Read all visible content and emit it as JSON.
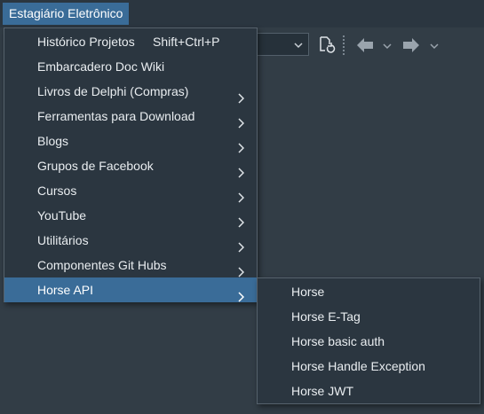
{
  "menubar": {
    "title": "Estagiário Eletrônico"
  },
  "main_menu": {
    "items": [
      {
        "label": "Histórico Projetos",
        "shortcut": "Shift+Ctrl+P",
        "submenu": false,
        "active": false
      },
      {
        "label": "Embarcadero Doc Wiki",
        "shortcut": "",
        "submenu": false,
        "active": false
      },
      {
        "label": "Livros de Delphi (Compras)",
        "shortcut": "",
        "submenu": true,
        "active": false
      },
      {
        "label": "Ferramentas para Download",
        "shortcut": "",
        "submenu": true,
        "active": false
      },
      {
        "label": "Blogs",
        "shortcut": "",
        "submenu": true,
        "active": false
      },
      {
        "label": "Grupos de Facebook",
        "shortcut": "",
        "submenu": true,
        "active": false
      },
      {
        "label": "Cursos",
        "shortcut": "",
        "submenu": true,
        "active": false
      },
      {
        "label": "YouTube",
        "shortcut": "",
        "submenu": true,
        "active": false
      },
      {
        "label": "Utilitários",
        "shortcut": "",
        "submenu": true,
        "active": false
      },
      {
        "label": "Componentes Git Hubs",
        "shortcut": "",
        "submenu": true,
        "active": false
      },
      {
        "label": "Horse API",
        "shortcut": "",
        "submenu": true,
        "active": true
      }
    ]
  },
  "submenu": {
    "items": [
      {
        "label": "Horse"
      },
      {
        "label": "Horse E-Tag"
      },
      {
        "label": "Horse basic auth"
      },
      {
        "label": "Horse Handle Exception"
      },
      {
        "label": "Horse JWT"
      }
    ]
  },
  "toolbar": {
    "icons": [
      "dropdown-combo",
      "refresh-document-icon",
      "back-arrow-icon",
      "forward-arrow-icon"
    ]
  },
  "colors": {
    "background": "#323d46",
    "menu_bg": "#2b3640",
    "highlight": "#3a6c98",
    "text": "#e9edf0"
  }
}
